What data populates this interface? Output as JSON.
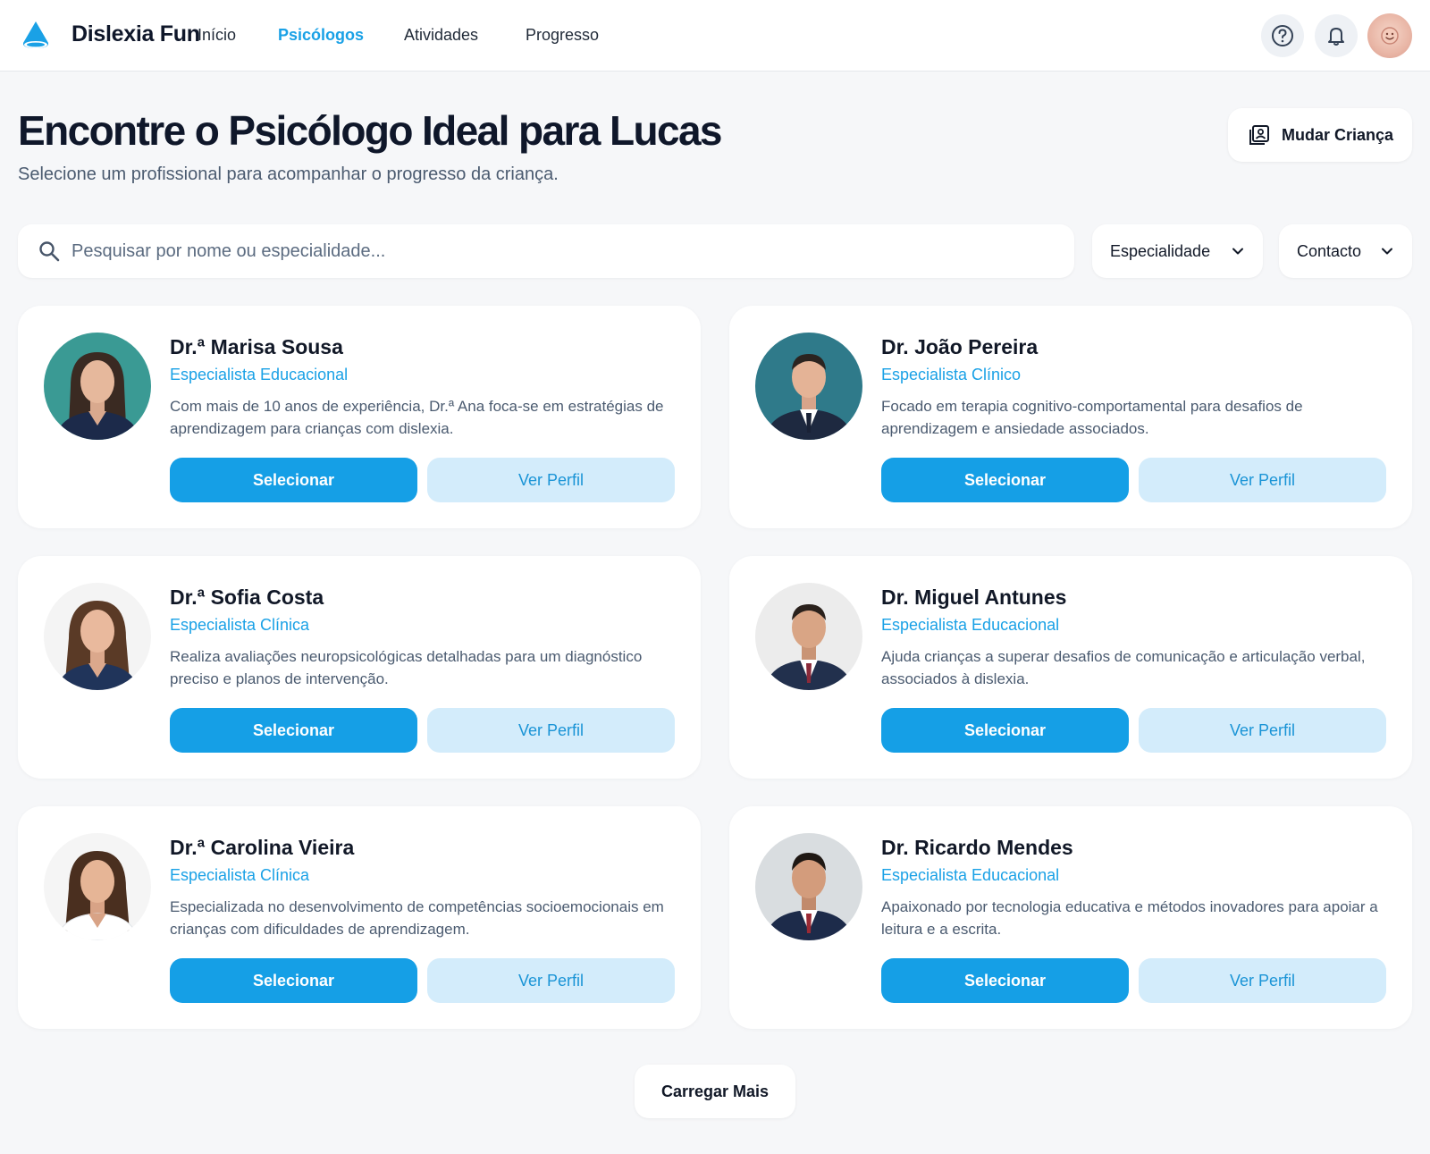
{
  "app": {
    "brand": "Dislexia Fun",
    "logo_icon": "droplet-icon",
    "accent": "#1aa1e6"
  },
  "nav": {
    "items": [
      {
        "label": "Início",
        "active": false
      },
      {
        "label": "Psicólogos",
        "active": true
      },
      {
        "label": "Atividades",
        "active": false
      },
      {
        "label": "Progresso",
        "active": false
      }
    ]
  },
  "header_actions": {
    "help_icon": "help-circle-icon",
    "bell_icon": "bell-icon",
    "avatar_icon": "user-avatar"
  },
  "page": {
    "title": "Encontre o Psicólogo Ideal para Lucas",
    "subtitle": "Selecione um profissional para acompanhar o progresso da criança.",
    "change_child_label": "Mudar Criança"
  },
  "filters": {
    "search_placeholder": "Pesquisar por nome ou especialidade...",
    "specialty_label": "Especialidade",
    "contact_label": "Contacto"
  },
  "psychologists": [
    {
      "name": "Dr.ª Marisa Sousa",
      "specialty": "Especialista Educacional",
      "description": "Com mais de 10 anos de experiência, Dr.ª Ana foca-se em estratégias de aprendizagem para crianças com dislexia.",
      "select_label": "Selecionar",
      "profile_label": "Ver Perfil"
    },
    {
      "name": "Dr. João Pereira",
      "specialty": "Especialista Clínico",
      "description": "Focado em terapia cognitivo-comportamental para desafios de aprendizagem e ansiedade associados.",
      "select_label": "Selecionar",
      "profile_label": "Ver Perfil"
    },
    {
      "name": "Dr.ª Sofia Costa",
      "specialty": "Especialista Clínica",
      "description": "Realiza avaliações neuropsicológicas detalhadas para um diagnóstico preciso e planos de intervenção.",
      "select_label": "Selecionar",
      "profile_label": "Ver Perfil"
    },
    {
      "name": "Dr. Miguel Antunes",
      "specialty": "Especialista Educacional",
      "description": "Ajuda crianças a superar desafios de comunicação e articulação verbal, associados à dislexia.",
      "select_label": "Selecionar",
      "profile_label": "Ver Perfil"
    },
    {
      "name": "Dr.ª Carolina Vieira",
      "specialty": "Especialista Clínica",
      "description": "Especializada no desenvolvimento de competências socioemocionais em crianças com dificuldades de aprendizagem.",
      "select_label": "Selecionar",
      "profile_label": "Ver Perfil"
    },
    {
      "name": "Dr. Ricardo Mendes",
      "specialty": "Especialista Educacional",
      "description": "Apaixonado por tecnologia educativa e métodos inovadores para apoiar a leitura e a escrita.",
      "select_label": "Selecionar",
      "profile_label": "Ver Perfil"
    }
  ],
  "load_more_label": "Carregar Mais"
}
